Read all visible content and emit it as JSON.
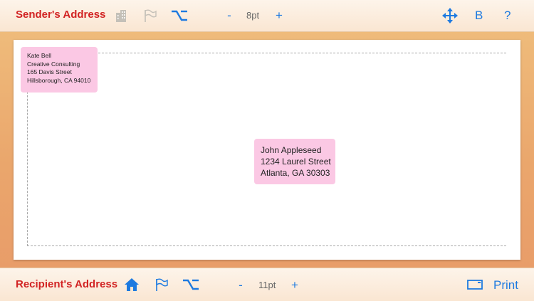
{
  "top_toolbar": {
    "title": "Sender's Address",
    "font_size": "8pt",
    "minus_label": "-",
    "plus_label": "+",
    "bold_label": "B",
    "help_label": "?"
  },
  "bottom_toolbar": {
    "title": "Recipient's Address",
    "font_size": "11pt",
    "minus_label": "-",
    "plus_label": "+",
    "print_label": "Print"
  },
  "sender": {
    "lines": [
      "Kate Bell",
      "Creative Consulting",
      "165 Davis Street",
      "Hillsborough, CA 94010"
    ]
  },
  "recipient": {
    "lines": [
      "John Appleseed",
      "1234 Laurel Street",
      "Atlanta, GA 30303"
    ]
  },
  "colors": {
    "accent": "#1e7ae0",
    "title_red": "#d22323",
    "label_pink": "#fbc8e4",
    "disabled_grey": "#b9b5ae"
  },
  "icons": [
    "building-icon",
    "flag-icon",
    "option-key-icon",
    "move-arrows-icon",
    "home-icon",
    "envelope-outline-icon"
  ]
}
